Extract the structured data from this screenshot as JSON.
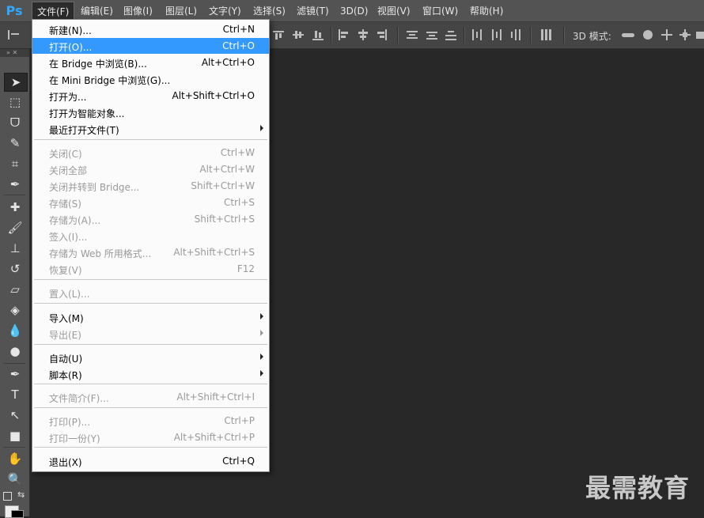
{
  "app": {
    "logo": "Ps"
  },
  "menubar": [
    "文件(F)",
    "编辑(E)",
    "图像(I)",
    "图层(L)",
    "文字(Y)",
    "选择(S)",
    "滤镜(T)",
    "3D(D)",
    "视图(V)",
    "窗口(W)",
    "帮助(H)"
  ],
  "options": {
    "mode3d_label": "3D 模式:"
  },
  "file_menu": [
    {
      "label": "新建(N)...",
      "shortcut": "Ctrl+N"
    },
    {
      "label": "打开(O)...",
      "shortcut": "Ctrl+O",
      "highlighted": true
    },
    {
      "label": "在 Bridge 中浏览(B)...",
      "shortcut": "Alt+Ctrl+O"
    },
    {
      "label": "在 Mini Bridge 中浏览(G)...",
      "shortcut": ""
    },
    {
      "label": "打开为...",
      "shortcut": "Alt+Shift+Ctrl+O"
    },
    {
      "label": "打开为智能对象...",
      "shortcut": ""
    },
    {
      "label": "最近打开文件(T)",
      "shortcut": "",
      "submenu": true
    },
    {
      "label": "关闭(C)",
      "shortcut": "Ctrl+W",
      "disabled": true
    },
    {
      "label": "关闭全部",
      "shortcut": "Alt+Ctrl+W",
      "disabled": true
    },
    {
      "label": "关闭并转到 Bridge...",
      "shortcut": "Shift+Ctrl+W",
      "disabled": true
    },
    {
      "label": "存储(S)",
      "shortcut": "Ctrl+S",
      "disabled": true
    },
    {
      "label": "存储为(A)...",
      "shortcut": "Shift+Ctrl+S",
      "disabled": true
    },
    {
      "label": "签入(I)...",
      "shortcut": "",
      "disabled": true
    },
    {
      "label": "存储为 Web 所用格式...",
      "shortcut": "Alt+Shift+Ctrl+S",
      "disabled": true
    },
    {
      "label": "恢复(V)",
      "shortcut": "F12",
      "disabled": true
    },
    {
      "label": "置入(L)...",
      "shortcut": "",
      "disabled": true
    },
    {
      "label": "导入(M)",
      "shortcut": "",
      "submenu": true
    },
    {
      "label": "导出(E)",
      "shortcut": "",
      "submenu": true,
      "disabled": true
    },
    {
      "label": "自动(U)",
      "shortcut": "",
      "submenu": true
    },
    {
      "label": "脚本(R)",
      "shortcut": "",
      "submenu": true
    },
    {
      "label": "文件简介(F)...",
      "shortcut": "Alt+Shift+Ctrl+I",
      "disabled": true
    },
    {
      "label": "打印(P)...",
      "shortcut": "Ctrl+P",
      "disabled": true
    },
    {
      "label": "打印一份(Y)",
      "shortcut": "Alt+Shift+Ctrl+P",
      "disabled": true
    },
    {
      "label": "退出(X)",
      "shortcut": "Ctrl+Q"
    }
  ],
  "tools": [
    {
      "name": "move-tool",
      "glyph": "➤"
    },
    {
      "name": "marquee-tool",
      "glyph": "⬚"
    },
    {
      "name": "lasso-tool",
      "glyph": "ᗜ"
    },
    {
      "name": "quick-selection-tool",
      "glyph": "✎"
    },
    {
      "name": "crop-tool",
      "glyph": "⌗"
    },
    {
      "name": "eyedropper-tool",
      "glyph": "✒"
    },
    {
      "name": "healing-brush-tool",
      "glyph": "✚"
    },
    {
      "name": "brush-tool",
      "glyph": "🖌"
    },
    {
      "name": "clone-stamp-tool",
      "glyph": "⊥"
    },
    {
      "name": "history-brush-tool",
      "glyph": "↺"
    },
    {
      "name": "eraser-tool",
      "glyph": "▱"
    },
    {
      "name": "paint-bucket-tool",
      "glyph": "◈"
    },
    {
      "name": "blur-tool",
      "glyph": "💧"
    },
    {
      "name": "dodge-tool",
      "glyph": "●"
    },
    {
      "name": "pen-tool",
      "glyph": "✒"
    },
    {
      "name": "type-tool",
      "glyph": "T"
    },
    {
      "name": "path-selection-tool",
      "glyph": "↖"
    },
    {
      "name": "rectangle-tool",
      "glyph": "■"
    },
    {
      "name": "hand-tool",
      "glyph": "✋"
    },
    {
      "name": "zoom-tool",
      "glyph": "🔍"
    }
  ],
  "watermark": "最需教育"
}
